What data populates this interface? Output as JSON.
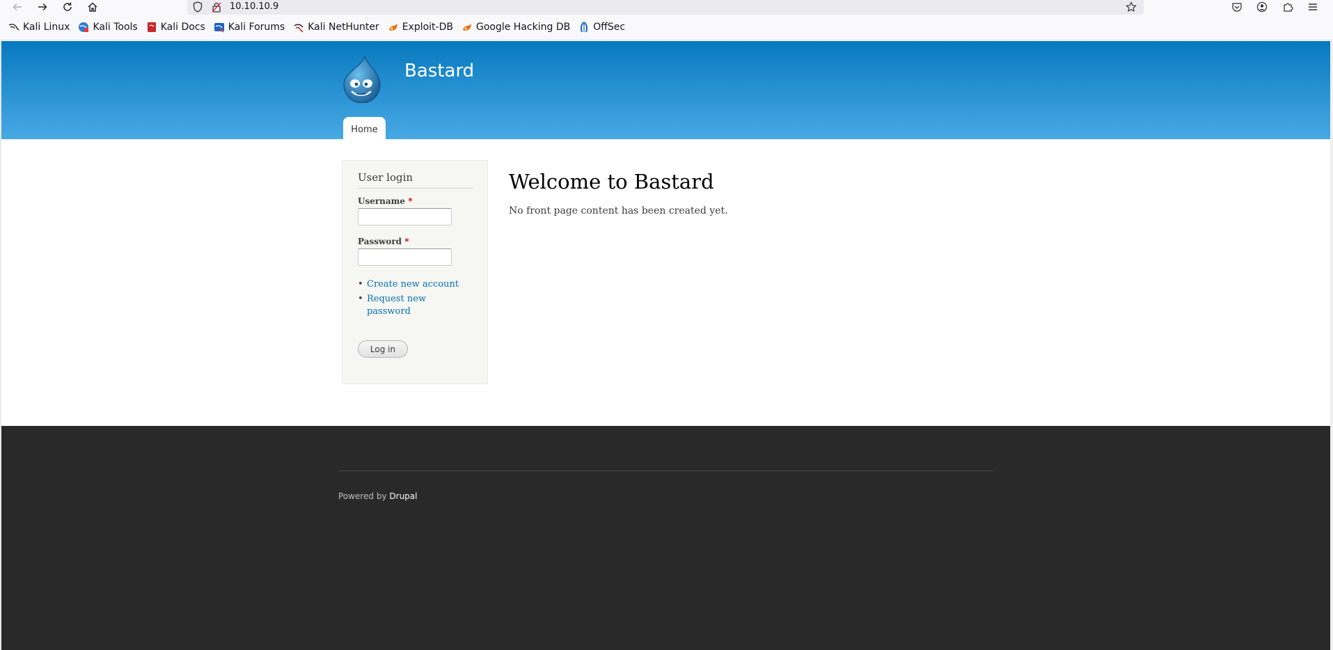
{
  "browser": {
    "url": "10.10.10.9",
    "bookmarks": [
      {
        "label": "Kali Linux",
        "icon": "kali-dragon-icon"
      },
      {
        "label": "Kali Tools",
        "icon": "kali-tools-icon"
      },
      {
        "label": "Kali Docs",
        "icon": "kali-docs-icon"
      },
      {
        "label": "Kali Forums",
        "icon": "kali-forums-icon"
      },
      {
        "label": "Kali NetHunter",
        "icon": "kali-nethunter-icon"
      },
      {
        "label": "Exploit-DB",
        "icon": "exploit-db-icon"
      },
      {
        "label": "Google Hacking DB",
        "icon": "exploit-db-icon"
      },
      {
        "label": "OffSec",
        "icon": "offsec-icon"
      }
    ]
  },
  "site": {
    "name": "Bastard",
    "nav": {
      "home": "Home"
    },
    "accent": "#0779bf"
  },
  "login": {
    "title": "User login",
    "username_label": "Username",
    "password_label": "Password",
    "required_marker": "*",
    "username_value": "",
    "password_value": "",
    "links": {
      "create_account": "Create new account",
      "request_password_line1": "Request new",
      "request_password_line2": "password"
    },
    "submit": "Log in"
  },
  "main": {
    "title": "Welcome to Bastard",
    "body": "No front page content has been created yet."
  },
  "footer": {
    "powered_by": "Powered by",
    "drupal": "Drupal"
  }
}
